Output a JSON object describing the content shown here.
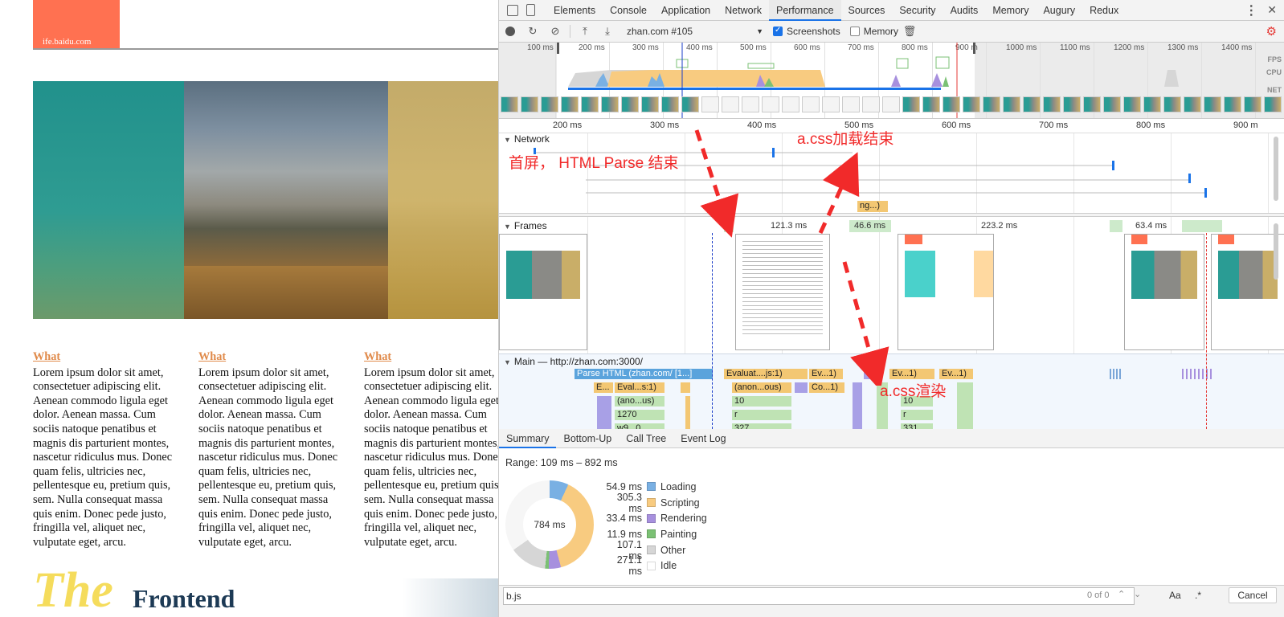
{
  "page": {
    "logo_text": "ife.baidu.com",
    "columns": [
      {
        "heading": "What",
        "body": "Lorem ipsum dolor sit amet,\nconsectetuer adipiscing elit.\nAenean commodo ligula eget\ndolor. Aenean massa. Cum\nsociis natoque penatibus et\nmagnis dis parturient montes,\nnascetur ridiculus mus. Donec\nquam felis, ultricies nec,\npellentesque eu, pretium quis,\nsem. Nulla consequat massa\nquis enim. Donec pede justo,\nfringilla vel, aliquet nec,\nvulputate eget, arcu."
      },
      {
        "heading": "What",
        "body": "Lorem ipsum dolor sit amet,\nconsectetuer adipiscing elit.\nAenean commodo ligula eget\ndolor. Aenean massa. Cum\nsociis natoque penatibus et\nmagnis dis parturient montes,\nnascetur ridiculus mus. Donec\nquam felis, ultricies nec,\npellentesque eu, pretium quis,\nsem. Nulla consequat massa\nquis enim. Donec pede justo,\nfringilla vel, aliquet nec,\nvulputate eget, arcu."
      },
      {
        "heading": "What",
        "body": "Lorem ipsum dolor sit amet,\nconsectetuer adipiscing elit.\nAenean commodo ligula eget\ndolor. Aenean massa. Cum\nsociis natoque penatibus et\nmagnis dis parturient montes,\nnascetur ridiculus mus. Donec\nquam felis, ultricies nec,\npellentesque eu, pretium quis,\nsem. Nulla consequat massa\nquis enim. Donec pede justo,\nfringilla vel, aliquet nec,\nvulputate eget, arcu."
      }
    ],
    "footer_the": "The",
    "footer_frontend": "Frontend"
  },
  "devtools": {
    "tabs": [
      "Elements",
      "Console",
      "Application",
      "Network",
      "Performance",
      "Sources",
      "Security",
      "Audits",
      "Memory",
      "Augury",
      "Redux"
    ],
    "active_tab": "Performance",
    "toolbar": {
      "target": "zhan.com #105",
      "screenshots_label": "Screenshots",
      "screenshots_checked": true,
      "memory_label": "Memory",
      "memory_checked": false
    },
    "overview_ticks": [
      "100 ms",
      "200 ms",
      "300 ms",
      "400 ms",
      "500 ms",
      "600 ms",
      "700 ms",
      "800 ms",
      "900 m",
      "1000 ms",
      "1100 ms",
      "1200 ms",
      "1300 ms",
      "1400 ms"
    ],
    "overview_labels": {
      "fps": "FPS",
      "cpu": "CPU",
      "net": "NET"
    },
    "ruler_ticks": [
      "200 ms",
      "300 ms",
      "400 ms",
      "500 ms",
      "600 ms",
      "700 ms",
      "800 ms",
      "900 m"
    ],
    "sections": {
      "network": "Network",
      "frames": "Frames",
      "main": "Main — http://zhan.com:3000/"
    },
    "network_pending": "ng...)",
    "frame_times": [
      "121.3 ms",
      "46.6 ms",
      "223.2 ms",
      "63.4 ms"
    ],
    "flame": {
      "parse_html": "Parse HTML (zhan.com/ [1...]",
      "evaluate": "Evaluat....js:1)",
      "ev1": "Ev...1)",
      "ev2": "Ev...1)",
      "ev3": "Ev...1)",
      "e": "E...",
      "evals": "Eval...s:1)",
      "anonous": "(anon...ous)",
      "co": "Co...1)",
      "anonus": "(ano...us)",
      "n10a": "10",
      "n10b": "10",
      "n1270": "1270",
      "ra": "r",
      "rb": "r",
      "n327": "327",
      "n331": "331",
      "w": "w9...0"
    },
    "annotations": {
      "first_screen": "首屏， HTML Parse 结束",
      "css_loaded": "a.css加载结束",
      "css_render": "a.css渲染"
    },
    "summary_tabs": [
      "Summary",
      "Bottom-Up",
      "Call Tree",
      "Event Log"
    ],
    "range": "Range: 109 ms – 892 ms",
    "total": "784 ms",
    "summary": [
      {
        "value": "54.9 ms",
        "label": "Loading",
        "color": "#79b0e3"
      },
      {
        "value": "305.3 ms",
        "label": "Scripting",
        "color": "#f8cb80"
      },
      {
        "value": "33.4 ms",
        "label": "Rendering",
        "color": "#a790de"
      },
      {
        "value": "11.9 ms",
        "label": "Painting",
        "color": "#7bc174"
      },
      {
        "value": "107.1 ms",
        "label": "Other",
        "color": "#d6d6d6"
      },
      {
        "value": "271.1 ms",
        "label": "Idle",
        "color": "#ffffff"
      }
    ],
    "search": {
      "value": "b.js",
      "count": "0 of 0",
      "aa": "Aa",
      "regex": ".*",
      "cancel": "Cancel"
    }
  }
}
